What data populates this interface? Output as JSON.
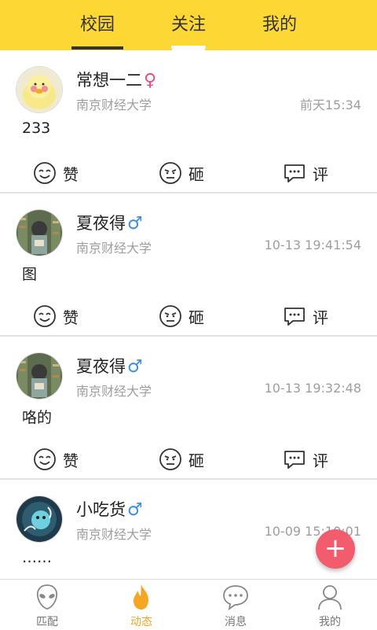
{
  "header": {
    "tabs": [
      {
        "label": "校园",
        "active": true
      },
      {
        "label": "关注",
        "active": false
      },
      {
        "label": "我的",
        "active": false
      }
    ],
    "background": "#fdd835"
  },
  "posts": [
    {
      "name": "常想一二",
      "gender_symbol": "♀",
      "school": "南京财经大学",
      "time": "前天15:34",
      "content": "233",
      "actions": {
        "like": "赞",
        "smash": "砸",
        "comment": "评"
      }
    },
    {
      "name": "夏夜得",
      "gender_symbol": "♂",
      "school": "南京财经大学",
      "time": "10-13 19:41:54",
      "content": "图",
      "actions": {
        "like": "赞",
        "smash": "砸",
        "comment": "评"
      }
    },
    {
      "name": "夏夜得",
      "gender_symbol": "♂",
      "school": "南京财经大学",
      "time": "10-13 19:32:48",
      "content": "咯的",
      "actions": {
        "like": "赞",
        "smash": "砸",
        "comment": "评"
      }
    },
    {
      "name": "小吃货",
      "gender_symbol": "♂",
      "school": "南京财经大学",
      "time": "10-09 15:10:01",
      "content": "……",
      "actions": {
        "like": "赞",
        "smash": "砸",
        "comment": "评"
      }
    }
  ],
  "fab": {
    "symbol": "+",
    "color": "#f25c6c"
  },
  "bottom_nav": [
    {
      "label": "匹配",
      "icon": "alien-icon",
      "active": false
    },
    {
      "label": "动态",
      "icon": "flame-icon",
      "active": true
    },
    {
      "label": "消息",
      "icon": "chat-bubble-icon",
      "active": false
    },
    {
      "label": "我的",
      "icon": "person-icon",
      "active": false
    }
  ],
  "colors": {
    "gender_female": "#e84a8e",
    "gender_male": "#3a8ee6",
    "active_nav": "#f5a623"
  }
}
